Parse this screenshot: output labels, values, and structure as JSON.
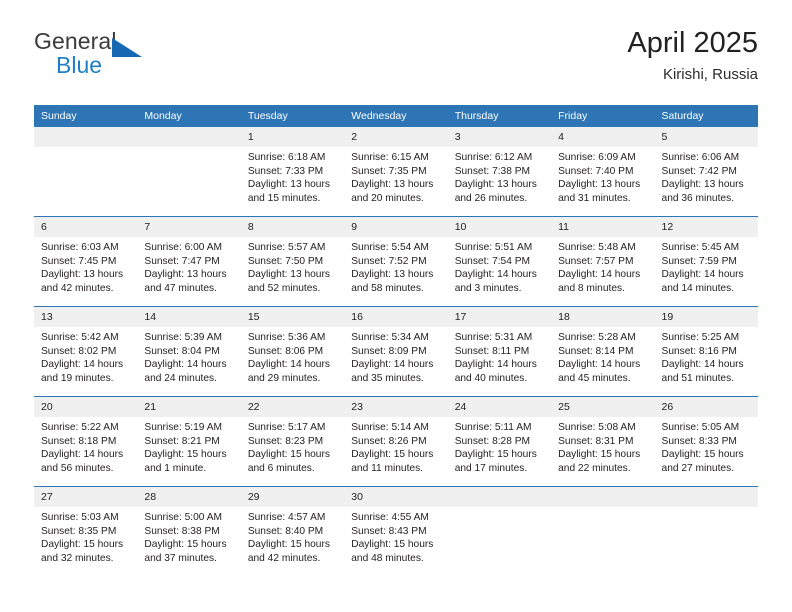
{
  "brand": {
    "name_top": "General",
    "name_bottom": "Blue",
    "color_dark": "#3b3b3b",
    "color_blue": "#1f7fc4",
    "triangle_color": "#1668b3"
  },
  "header": {
    "title": "April 2025",
    "subtitle": "Kirishi, Russia"
  },
  "theme": {
    "header_bg": "#2e75b6",
    "header_text": "#ffffff",
    "daynum_bg": "#f0f0f0",
    "grid_line": "#2e75b6",
    "body_text": "#231f20"
  },
  "weekday_headers": [
    "Sunday",
    "Monday",
    "Tuesday",
    "Wednesday",
    "Thursday",
    "Friday",
    "Saturday"
  ],
  "weeks": [
    [
      {
        "day": "",
        "sunrise": "",
        "sunset": "",
        "daylight1": "",
        "daylight2": ""
      },
      {
        "day": "",
        "sunrise": "",
        "sunset": "",
        "daylight1": "",
        "daylight2": ""
      },
      {
        "day": "1",
        "sunrise": "Sunrise: 6:18 AM",
        "sunset": "Sunset: 7:33 PM",
        "daylight1": "Daylight: 13 hours",
        "daylight2": "and 15 minutes."
      },
      {
        "day": "2",
        "sunrise": "Sunrise: 6:15 AM",
        "sunset": "Sunset: 7:35 PM",
        "daylight1": "Daylight: 13 hours",
        "daylight2": "and 20 minutes."
      },
      {
        "day": "3",
        "sunrise": "Sunrise: 6:12 AM",
        "sunset": "Sunset: 7:38 PM",
        "daylight1": "Daylight: 13 hours",
        "daylight2": "and 26 minutes."
      },
      {
        "day": "4",
        "sunrise": "Sunrise: 6:09 AM",
        "sunset": "Sunset: 7:40 PM",
        "daylight1": "Daylight: 13 hours",
        "daylight2": "and 31 minutes."
      },
      {
        "day": "5",
        "sunrise": "Sunrise: 6:06 AM",
        "sunset": "Sunset: 7:42 PM",
        "daylight1": "Daylight: 13 hours",
        "daylight2": "and 36 minutes."
      }
    ],
    [
      {
        "day": "6",
        "sunrise": "Sunrise: 6:03 AM",
        "sunset": "Sunset: 7:45 PM",
        "daylight1": "Daylight: 13 hours",
        "daylight2": "and 42 minutes."
      },
      {
        "day": "7",
        "sunrise": "Sunrise: 6:00 AM",
        "sunset": "Sunset: 7:47 PM",
        "daylight1": "Daylight: 13 hours",
        "daylight2": "and 47 minutes."
      },
      {
        "day": "8",
        "sunrise": "Sunrise: 5:57 AM",
        "sunset": "Sunset: 7:50 PM",
        "daylight1": "Daylight: 13 hours",
        "daylight2": "and 52 minutes."
      },
      {
        "day": "9",
        "sunrise": "Sunrise: 5:54 AM",
        "sunset": "Sunset: 7:52 PM",
        "daylight1": "Daylight: 13 hours",
        "daylight2": "and 58 minutes."
      },
      {
        "day": "10",
        "sunrise": "Sunrise: 5:51 AM",
        "sunset": "Sunset: 7:54 PM",
        "daylight1": "Daylight: 14 hours",
        "daylight2": "and 3 minutes."
      },
      {
        "day": "11",
        "sunrise": "Sunrise: 5:48 AM",
        "sunset": "Sunset: 7:57 PM",
        "daylight1": "Daylight: 14 hours",
        "daylight2": "and 8 minutes."
      },
      {
        "day": "12",
        "sunrise": "Sunrise: 5:45 AM",
        "sunset": "Sunset: 7:59 PM",
        "daylight1": "Daylight: 14 hours",
        "daylight2": "and 14 minutes."
      }
    ],
    [
      {
        "day": "13",
        "sunrise": "Sunrise: 5:42 AM",
        "sunset": "Sunset: 8:02 PM",
        "daylight1": "Daylight: 14 hours",
        "daylight2": "and 19 minutes."
      },
      {
        "day": "14",
        "sunrise": "Sunrise: 5:39 AM",
        "sunset": "Sunset: 8:04 PM",
        "daylight1": "Daylight: 14 hours",
        "daylight2": "and 24 minutes."
      },
      {
        "day": "15",
        "sunrise": "Sunrise: 5:36 AM",
        "sunset": "Sunset: 8:06 PM",
        "daylight1": "Daylight: 14 hours",
        "daylight2": "and 29 minutes."
      },
      {
        "day": "16",
        "sunrise": "Sunrise: 5:34 AM",
        "sunset": "Sunset: 8:09 PM",
        "daylight1": "Daylight: 14 hours",
        "daylight2": "and 35 minutes."
      },
      {
        "day": "17",
        "sunrise": "Sunrise: 5:31 AM",
        "sunset": "Sunset: 8:11 PM",
        "daylight1": "Daylight: 14 hours",
        "daylight2": "and 40 minutes."
      },
      {
        "day": "18",
        "sunrise": "Sunrise: 5:28 AM",
        "sunset": "Sunset: 8:14 PM",
        "daylight1": "Daylight: 14 hours",
        "daylight2": "and 45 minutes."
      },
      {
        "day": "19",
        "sunrise": "Sunrise: 5:25 AM",
        "sunset": "Sunset: 8:16 PM",
        "daylight1": "Daylight: 14 hours",
        "daylight2": "and 51 minutes."
      }
    ],
    [
      {
        "day": "20",
        "sunrise": "Sunrise: 5:22 AM",
        "sunset": "Sunset: 8:18 PM",
        "daylight1": "Daylight: 14 hours",
        "daylight2": "and 56 minutes."
      },
      {
        "day": "21",
        "sunrise": "Sunrise: 5:19 AM",
        "sunset": "Sunset: 8:21 PM",
        "daylight1": "Daylight: 15 hours",
        "daylight2": "and 1 minute."
      },
      {
        "day": "22",
        "sunrise": "Sunrise: 5:17 AM",
        "sunset": "Sunset: 8:23 PM",
        "daylight1": "Daylight: 15 hours",
        "daylight2": "and 6 minutes."
      },
      {
        "day": "23",
        "sunrise": "Sunrise: 5:14 AM",
        "sunset": "Sunset: 8:26 PM",
        "daylight1": "Daylight: 15 hours",
        "daylight2": "and 11 minutes."
      },
      {
        "day": "24",
        "sunrise": "Sunrise: 5:11 AM",
        "sunset": "Sunset: 8:28 PM",
        "daylight1": "Daylight: 15 hours",
        "daylight2": "and 17 minutes."
      },
      {
        "day": "25",
        "sunrise": "Sunrise: 5:08 AM",
        "sunset": "Sunset: 8:31 PM",
        "daylight1": "Daylight: 15 hours",
        "daylight2": "and 22 minutes."
      },
      {
        "day": "26",
        "sunrise": "Sunrise: 5:05 AM",
        "sunset": "Sunset: 8:33 PM",
        "daylight1": "Daylight: 15 hours",
        "daylight2": "and 27 minutes."
      }
    ],
    [
      {
        "day": "27",
        "sunrise": "Sunrise: 5:03 AM",
        "sunset": "Sunset: 8:35 PM",
        "daylight1": "Daylight: 15 hours",
        "daylight2": "and 32 minutes."
      },
      {
        "day": "28",
        "sunrise": "Sunrise: 5:00 AM",
        "sunset": "Sunset: 8:38 PM",
        "daylight1": "Daylight: 15 hours",
        "daylight2": "and 37 minutes."
      },
      {
        "day": "29",
        "sunrise": "Sunrise: 4:57 AM",
        "sunset": "Sunset: 8:40 PM",
        "daylight1": "Daylight: 15 hours",
        "daylight2": "and 42 minutes."
      },
      {
        "day": "30",
        "sunrise": "Sunrise: 4:55 AM",
        "sunset": "Sunset: 8:43 PM",
        "daylight1": "Daylight: 15 hours",
        "daylight2": "and 48 minutes."
      },
      {
        "day": "",
        "sunrise": "",
        "sunset": "",
        "daylight1": "",
        "daylight2": ""
      },
      {
        "day": "",
        "sunrise": "",
        "sunset": "",
        "daylight1": "",
        "daylight2": ""
      },
      {
        "day": "",
        "sunrise": "",
        "sunset": "",
        "daylight1": "",
        "daylight2": ""
      }
    ]
  ]
}
